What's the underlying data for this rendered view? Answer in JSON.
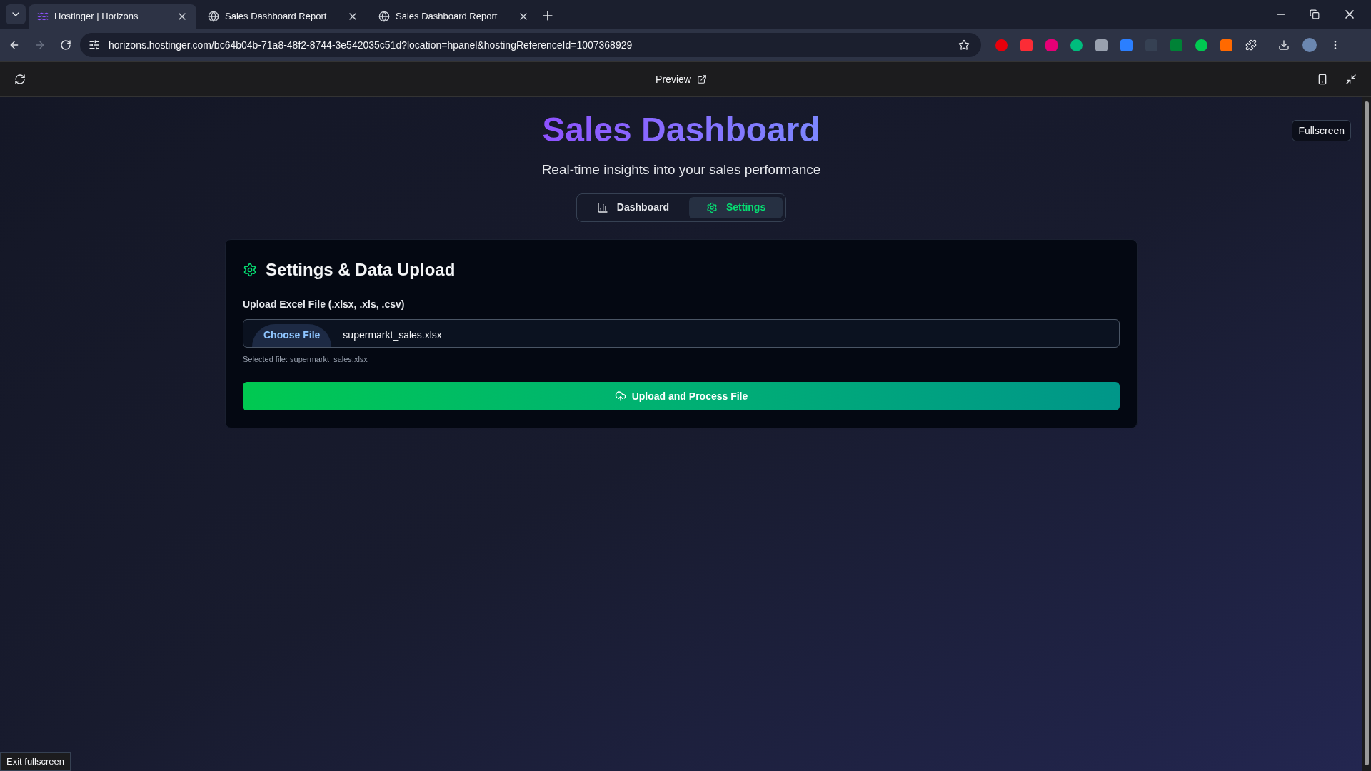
{
  "browser": {
    "tabs": [
      {
        "title": "Hostinger | Horizons",
        "selected": true,
        "kind": "brand"
      },
      {
        "title": "Sales Dashboard Report",
        "selected": false,
        "kind": "globe"
      },
      {
        "title": "Sales Dashboard Report",
        "selected": false,
        "kind": "globe"
      }
    ],
    "url": "horizons.hostinger.com/bc64b04b-71a8-48f2-8744-3e542035c51d?location=hpanel&hostingReferenceId=1007368929"
  },
  "preview_bar": {
    "label": "Preview"
  },
  "fullscreen_button": "Fullscreen",
  "exit_fullscreen_button": "Exit fullscreen",
  "app": {
    "title": "Sales Dashboard",
    "subtitle": "Real-time insights into your sales performance",
    "tabs": [
      {
        "label": "Dashboard",
        "selected": false,
        "kind": "chart"
      },
      {
        "label": "Settings",
        "selected": true,
        "kind": "settings"
      }
    ],
    "card": {
      "heading": "Settings & Data Upload",
      "field_label": "Upload Excel File (.xlsx, .xls, .csv)",
      "file_button": "Choose File",
      "file_name": "supermarkt_sales.xlsx",
      "selected_text": "Selected file: supermarkt_sales.xlsx",
      "upload_button": "Upload and Process File"
    }
  }
}
